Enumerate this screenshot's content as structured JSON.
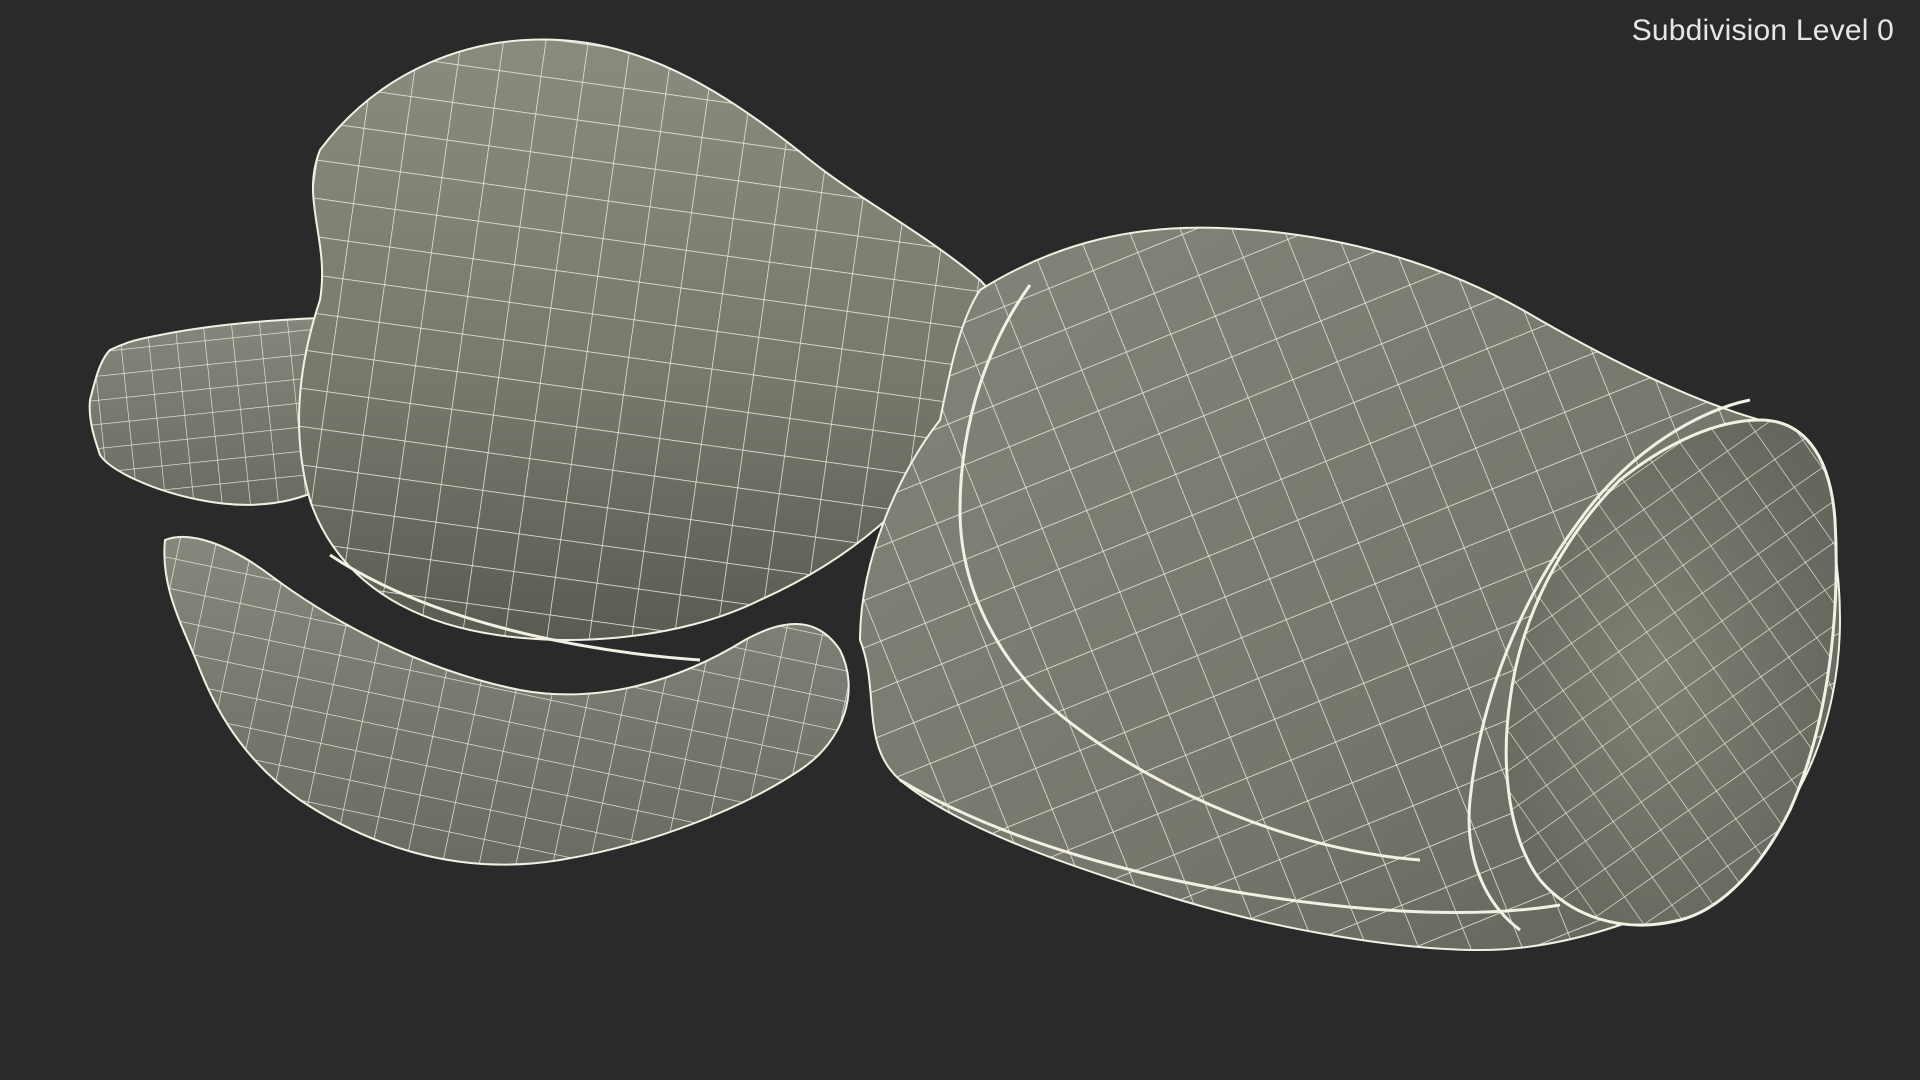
{
  "viewport": {
    "subdivision_label": "Subdivision Level 0"
  },
  "colors": {
    "background": "#2a2a2a",
    "surface": "#7b7b6f",
    "surface_shadow": "#55564d",
    "wire": "#f2f0e2"
  }
}
